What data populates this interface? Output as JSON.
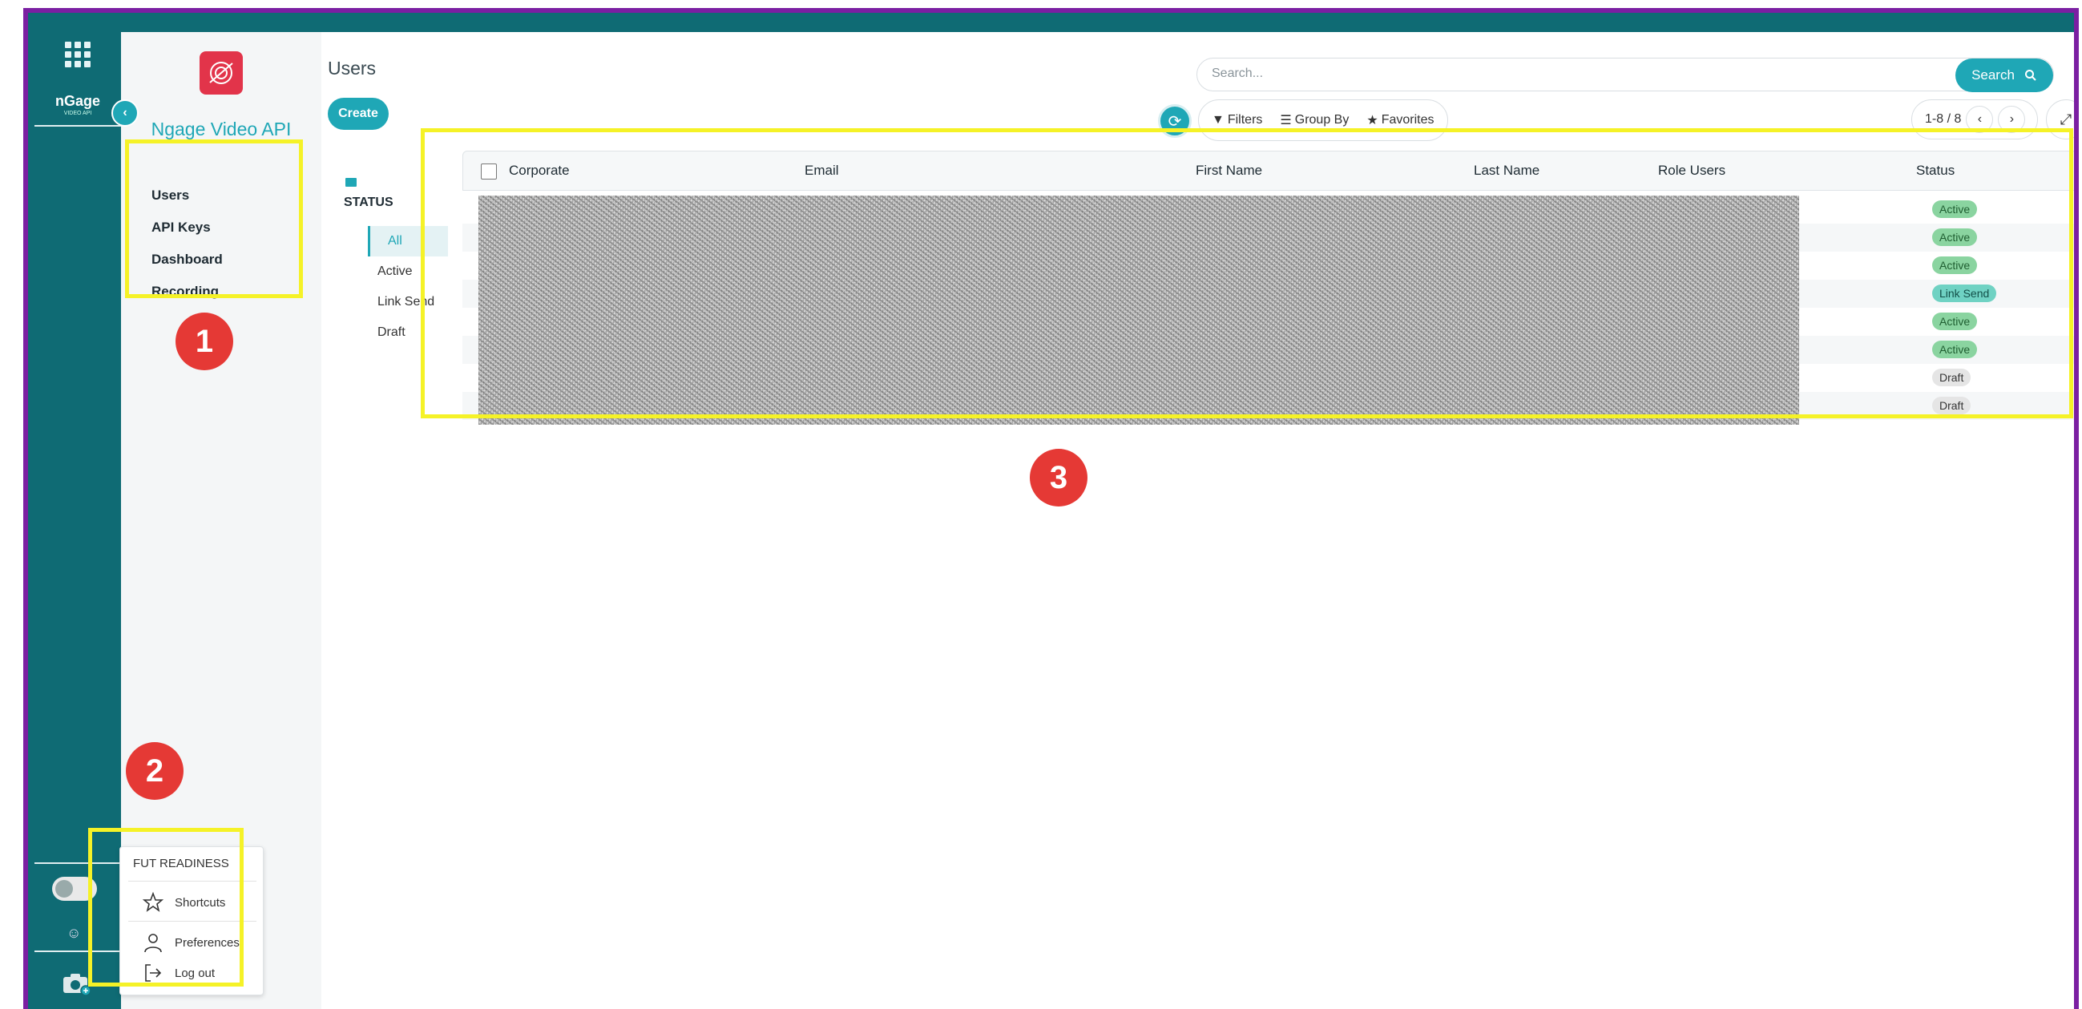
{
  "rail": {
    "logo": "nGage",
    "logo_sub": "VIDEO API"
  },
  "sidebar": {
    "app_name": "Ngage Video API",
    "items": [
      {
        "label": "Users"
      },
      {
        "label": "API Keys"
      },
      {
        "label": "Dashboard"
      },
      {
        "label": "Recording"
      }
    ]
  },
  "main": {
    "title": "Users",
    "create_label": "Create",
    "search": {
      "placeholder": "Search...",
      "button_label": "Search"
    },
    "filters": {
      "filters_label": "Filters",
      "group_by_label": "Group By",
      "favorites_label": "Favorites"
    },
    "pager": {
      "range": "1-8 / 8"
    }
  },
  "status_panel": {
    "title": "STATUS",
    "items": [
      {
        "label": "All"
      },
      {
        "label": "Active"
      },
      {
        "label": "Link Send"
      },
      {
        "label": "Draft"
      }
    ]
  },
  "table": {
    "columns": [
      "Corporate",
      "Email",
      "First Name",
      "Last Name",
      "Role Users",
      "Status"
    ],
    "rows": [
      {
        "status": "Active"
      },
      {
        "status": "Active"
      },
      {
        "status": "Active"
      },
      {
        "status": "Link Send"
      },
      {
        "status": "Active"
      },
      {
        "status": "Active"
      },
      {
        "status": "Draft"
      },
      {
        "status": "Draft"
      }
    ]
  },
  "user_menu": {
    "title": "FUT READINESS",
    "items": [
      {
        "label": "Shortcuts"
      },
      {
        "label": "Preferences"
      },
      {
        "label": "Log out"
      }
    ]
  },
  "annotations": [
    "1",
    "2",
    "3"
  ],
  "colors": {
    "accent": "#1fa7b6",
    "rail": "#0f6b74",
    "frame": "#7b1fa2",
    "highlight": "#f5f227",
    "marker": "#e53935",
    "badge_active": "#8ad4a0",
    "badge_link_send": "#6fd2c3",
    "badge_draft": "#e5e5e5"
  }
}
